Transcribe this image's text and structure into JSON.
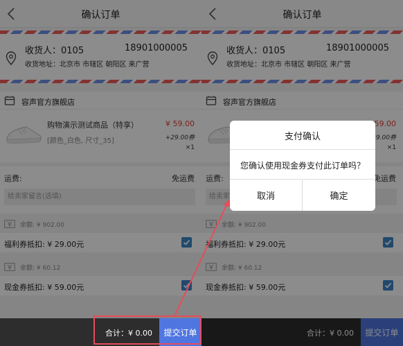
{
  "page": {
    "title": "确认订单",
    "receiver": "收货人：0105",
    "phone": "18901000005",
    "address": "收货地址：北京市 市辖区 朝阳区 来广营",
    "shop_name": "容声官方旗舰店",
    "product_name": "购物演示测试商品（特享）",
    "product_spec": "[颜色_白色, 尺寸_35]",
    "price": "¥ 59.00",
    "coupon_price": "+29.00券",
    "quantity": "×1",
    "shipping_label": "运费:",
    "shipping_value": "免运费",
    "remark_placeholder": "给卖家留言(选填)",
    "welfare_balance": "余额: ¥ 902.00",
    "welfare_deduct": "福利券抵扣: ¥ 29.00元",
    "welfare_checked": true,
    "cash_balance": "余额: ¥ 60.12",
    "cash_deduct": "现金券抵扣: ¥ 59.00元",
    "cash_checked": true,
    "total": "合计：¥ 0.00",
    "submit_label": "提交订单"
  },
  "dialog": {
    "title": "支付确认",
    "message": "您确认使用现金券支付此订单吗？",
    "cancel_label": "取消",
    "confirm_label": "确定"
  },
  "colors": {
    "accent": "#4f76e1",
    "price_red": "#e53935",
    "checkbox": "#3d86c6",
    "annotation": "#e74c5a",
    "bottom_bar": "#2d2d2d"
  },
  "icons": [
    "back-arrow-icon",
    "location-pin-icon",
    "shop-icon",
    "shoe-image",
    "ticket-icon",
    "checkmark-icon"
  ]
}
